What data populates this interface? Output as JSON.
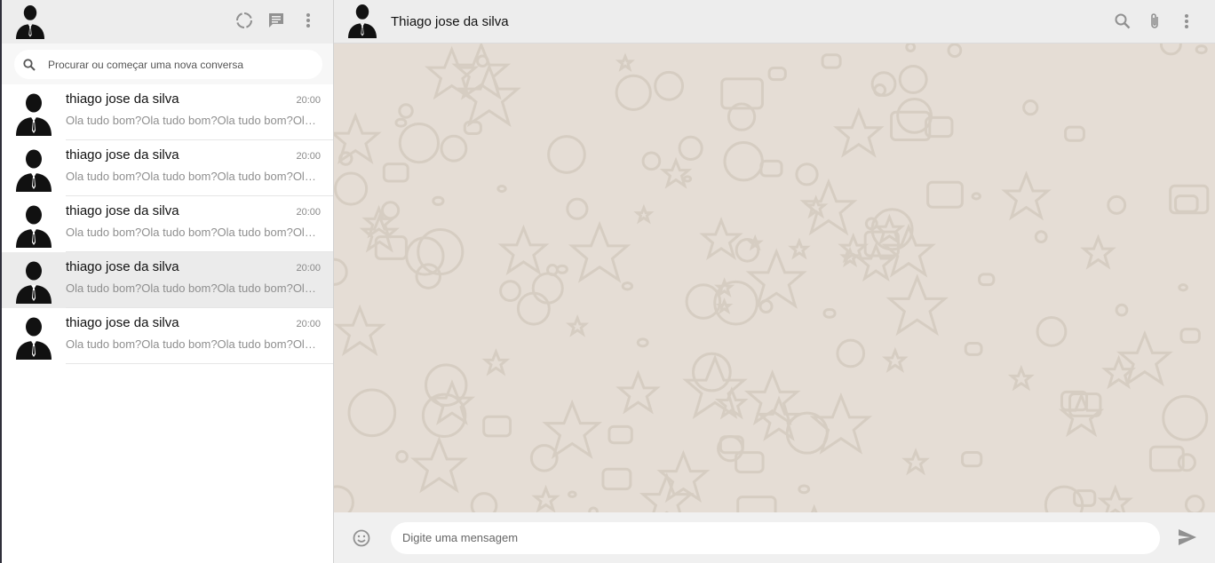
{
  "sidebar": {
    "search": {
      "placeholder": "Procurar ou começar uma nova conversa"
    },
    "icons": [
      "status-icon",
      "new-chat-icon",
      "menu-icon"
    ],
    "chats": [
      {
        "name": "thiago jose da silva",
        "time": "20:00",
        "preview": "Ola tudo bom?Ola tudo bom?Ola tudo bom?Ola tudo bom?",
        "active": false
      },
      {
        "name": "thiago jose da silva",
        "time": "20:00",
        "preview": "Ola tudo bom?Ola tudo bom?Ola tudo bom?Ola tudo bom?",
        "active": false
      },
      {
        "name": "thiago jose da silva",
        "time": "20:00",
        "preview": "Ola tudo bom?Ola tudo bom?Ola tudo bom?Ola tudo bom?",
        "active": false
      },
      {
        "name": "thiago jose da silva",
        "time": "20:00",
        "preview": "Ola tudo bom?Ola tudo bom?Ola tudo bom?Ola tudo bom?",
        "active": true
      },
      {
        "name": "thiago jose da silva",
        "time": "20:00",
        "preview": "Ola tudo bom?Ola tudo bom?Ola tudo bom?Ola tudo bom?",
        "active": false
      }
    ]
  },
  "conversation": {
    "title": "Thiago jose da silva",
    "icons": [
      "search-icon",
      "attach-icon",
      "menu-icon"
    ]
  },
  "composer": {
    "placeholder": "Digite uma mensagem",
    "icons": [
      "emoji-icon",
      "send-icon"
    ]
  },
  "colors": {
    "header_bg": "#ededed",
    "wallpaper_bg": "#e5ddd5",
    "active_chat_bg": "#ebebeb",
    "icon": "#919191"
  }
}
